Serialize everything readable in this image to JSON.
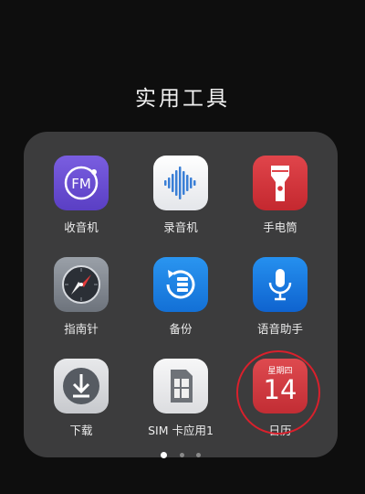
{
  "folder": {
    "title": "实用工具",
    "apps": [
      {
        "label": "收音机",
        "icon": "fm-radio-icon"
      },
      {
        "label": "录音机",
        "icon": "sound-recorder-icon"
      },
      {
        "label": "手电筒",
        "icon": "flashlight-icon"
      },
      {
        "label": "指南针",
        "icon": "compass-icon"
      },
      {
        "label": "备份",
        "icon": "backup-icon"
      },
      {
        "label": "语音助手",
        "icon": "voice-assistant-icon"
      },
      {
        "label": "下载",
        "icon": "download-icon"
      },
      {
        "label": "SIM 卡应用1",
        "icon": "sim-card-icon"
      },
      {
        "label": "日历",
        "icon": "calendar-icon",
        "weekday": "星期四",
        "day": "14"
      }
    ],
    "page_indicator": {
      "count": 3,
      "current": 1
    }
  },
  "colors": {
    "fm_radio": "#6a4fd2",
    "flashlight": "#d8343b",
    "backup": "#1a86e6",
    "voice": "#1576de",
    "calendar": "#d23a40",
    "annotation": "#d9202c"
  }
}
